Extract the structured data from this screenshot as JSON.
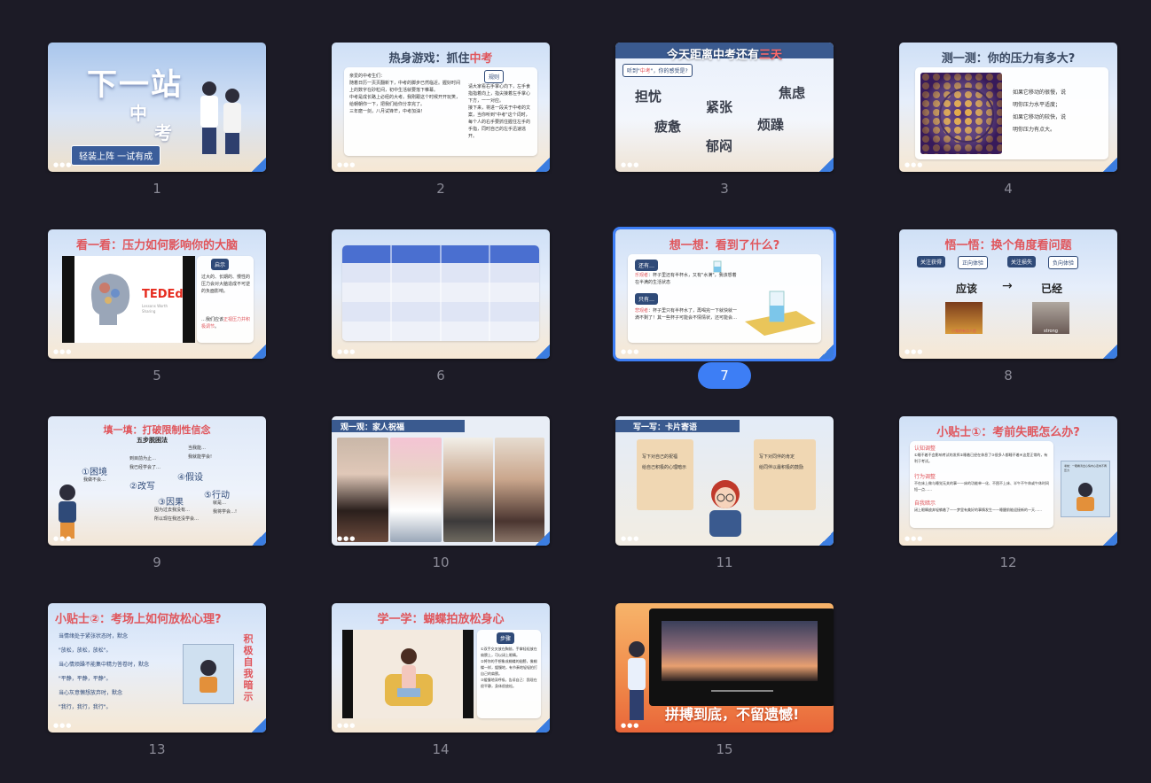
{
  "slides": [
    {
      "number": "1",
      "title_main": "下一站",
      "title_sub_a": "中",
      "title_sub_b": "考",
      "banner": "轻装上阵 一试有成"
    },
    {
      "number": "2",
      "title": "热身游戏：抓住",
      "title_red": "中考",
      "rule_label": "规则",
      "body_left": [
        "亲爱的中考生们：",
        "随着日历一页页翻新下，中考的脚步已然临近。握好时间上的数字在砂粒间，初中生活就要落下帷幕。",
        "中考是成长路上必经的大考。我刚跟这个时候开开玩笑，给朝朝你一下，把我们给你分享完了。",
        "三年磨一剑，八月试锋芒，中考加油！"
      ],
      "body_right": [
        "请大家看右手掌心向下，左手食指指着向上，指尖接着左手掌心下方，一一对应。",
        "接下来，将进一段关于中考的文案，当你听到\"中考\"这个词时，每个人的右手要抓住握住左手的手指，同时自己的左手迅速逃开。"
      ]
    },
    {
      "number": "3",
      "title": "今天距离中考还有",
      "title_red": "三天",
      "question_pre": "听到\"",
      "question_red": "中考",
      "question_post": "\"，你的感受是?",
      "moods": [
        "担忧",
        "紧张",
        "焦虑",
        "疲惫",
        "烦躁",
        "郁闷"
      ]
    },
    {
      "number": "4",
      "title": "测一测：你的压力有多大?",
      "body": [
        "如果它移动的很慢，说",
        "明你压力水平适度；",
        "如果它移动的较快，说",
        "明你压力有点大。"
      ]
    },
    {
      "number": "5",
      "title": "看一看：压力如何影响你的大脑",
      "label": "启示",
      "brand": "TEDEd",
      "brand_sub": "Lessons Worth Sharing",
      "body": "过大的、长期的、慢性的压力会对大脑造成不可逆的负面影响。",
      "body2_pre": "…我们应该",
      "body2_red": "正视压力并积极调节",
      "body2_post": "。"
    },
    {
      "number": "6",
      "table_rows": 5,
      "table_cols": 4
    },
    {
      "number": "7",
      "title": "想一想：看到了什么?",
      "tag_a": "还有…",
      "line_a_red": "乐观者",
      "line_a": "：杯子里还有半杯水，又有\"水满\"，我该想着在半满的生活状态",
      "tag_b": "只有…",
      "line_b_red": "悲观者",
      "line_b": "：杯子里只有半杯水了，再喝完一下就快就一滴不剩了！其一些杯子可能会不情情状，还可能会…"
    },
    {
      "number": "8",
      "title": "悟一悟：换个角度看问题",
      "pill_a": "关注获得",
      "pill_b": "正向体验",
      "pill_c": "关注损失",
      "pill_d": "负向体验",
      "word_a": "应该",
      "arrow": "→",
      "word_b": "已经",
      "photo_a_caption": "小鬼的有点人脸",
      "photo_b_caption": "strong"
    },
    {
      "number": "9",
      "title": "填一填：打破限制性信念",
      "subtitle": "五步脱困法",
      "steps": [
        "①困境",
        "②改写",
        "③因果",
        "④假设",
        "⑤行动"
      ],
      "notes": [
        "我做不会…",
        "到目前为止…",
        "我已经学会了…",
        "当我能…",
        "我就能学会!",
        "因为过去我没有…",
        "所以现在我还没学会…",
        "就是…",
        "我将学会…!"
      ]
    },
    {
      "number": "10",
      "title": "观一观：家人祝福"
    },
    {
      "number": "11",
      "title": "写一写：卡片寄语",
      "card_a": [
        "写下对自己的祝福",
        "给自己积极的心理暗示"
      ],
      "card_b": [
        "写下对同伴的肯定",
        "给同伴以最积极的鼓励"
      ]
    },
    {
      "number": "12",
      "title": "小贴士①：考前失眠怎么办?",
      "heads": [
        "认知调整",
        "行为调整",
        "自我暗示"
      ],
      "lines": [
        "①睡不着不会影响考试的发挥②睡着已经在休息了③很多人都睡不着④这是正常的，有利于考试。",
        "不在床上做与睡觉无关的事——床的功能单一化、不困不上床、半午不午休或午休时间短一点……",
        "闭上眼睛放弃轻躺着了——梦里有美好的事情发生——睡醒前能迎接新的一天……"
      ],
      "book_caption": "考前：一眼看清出心情内心走向不再压力"
    },
    {
      "number": "13",
      "title": "小贴士②：考场上如何放松心理?",
      "lines": [
        "当情绪处于紧张状态时，默念",
        "\"放松，放松，放松\"。",
        "当心情烦躁不能集中精力答卷时，默念",
        "\"平静，平静，平静\"。",
        "当心灰意懒想放弃时，默念",
        "\"我行，我行，我行\"。"
      ],
      "side_text": [
        "积",
        "极",
        "自",
        "我",
        "暗",
        "示"
      ]
    },
    {
      "number": "14",
      "title": "学一学：蝴蝶拍放松身心",
      "label": "步骤",
      "steps": [
        "①双手交叉放在胸前，手掌轻轻放在肩膀上，可以闭上眼睛。",
        "②将你的手想象成蝴蝶的翅膀，像蝴蝶一样，缓慢地，有节奏地轻轻拍打自己的肩膀。",
        "③缓慢地深呼吸，告诉自己：我现在很平静，身体很放松。"
      ]
    },
    {
      "number": "15",
      "slogan": "拼搏到底，不留遗憾!"
    }
  ],
  "selected_slide": "7",
  "colors": {
    "background": "#1c1b26",
    "selection": "#3d7ef5",
    "title_red": "#e0565c",
    "label_gray": "#8a8a96"
  }
}
